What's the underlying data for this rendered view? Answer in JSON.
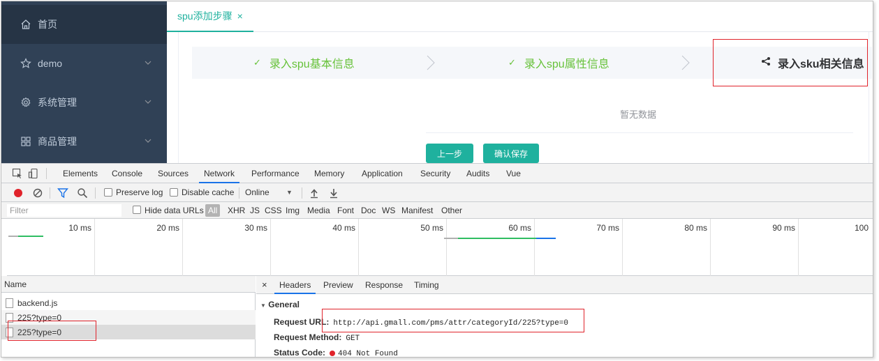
{
  "sidebar": {
    "items": [
      {
        "label": "首页",
        "icon": "home-icon"
      },
      {
        "label": "demo",
        "icon": "star-icon"
      },
      {
        "label": "系统管理",
        "icon": "gear-icon"
      },
      {
        "label": "商品管理",
        "icon": "grid-icon"
      }
    ],
    "bg_color": "#304156",
    "text_color": "#bfcbd9"
  },
  "tabs": {
    "active_label": "spu添加步骤",
    "close_glyph": "×"
  },
  "steps": [
    {
      "label": "录入spu基本信息",
      "status": "done",
      "check": "✓"
    },
    {
      "label": "录入spu属性信息",
      "status": "done",
      "check": "✓"
    },
    {
      "label": "录入sku相关信息",
      "status": "current",
      "icon": "share-icon"
    }
  ],
  "empty": {
    "text": "暂无数据"
  },
  "buttons": {
    "prev": "上一步",
    "confirm": "确认保存"
  },
  "accent_color": "#1fb19e",
  "devtools": {
    "tabs": [
      "Elements",
      "Console",
      "Sources",
      "Network",
      "Performance",
      "Memory",
      "Application",
      "Security",
      "Audits",
      "Vue"
    ],
    "active_tab": "Network",
    "toolbar": {
      "preserve_log": "Preserve log",
      "disable_cache": "Disable cache",
      "throttle": "Online",
      "throttle_arrow": "▼"
    },
    "filter": {
      "placeholder": "Filter",
      "hide_data_urls": "Hide data URLs",
      "types": [
        "All",
        "XHR",
        "JS",
        "CSS",
        "Img",
        "Media",
        "Font",
        "Doc",
        "WS",
        "Manifest",
        "Other"
      ]
    },
    "timeline": {
      "ticks": [
        "10 ms",
        "20 ms",
        "30 ms",
        "40 ms",
        "50 ms",
        "60 ms",
        "70 ms",
        "80 ms",
        "90 ms",
        "100"
      ]
    },
    "requests": {
      "header": "Name",
      "rows": [
        "backend.js",
        "225?type=0",
        "225?type=0"
      ],
      "selected_index": 2
    },
    "detail": {
      "close_glyph": "×",
      "tabs": [
        "Headers",
        "Preview",
        "Response",
        "Timing"
      ],
      "active_tab": "Headers",
      "section_title": "General",
      "section_arrow": "▼",
      "request_url_key": "Request URL:",
      "request_url": "http://api.gmall.com/pms/attr/categoryId/225?type=0",
      "request_method_key": "Request Method:",
      "request_method": "GET",
      "status_code_key": "Status Code:",
      "status_code": "404 Not Found"
    }
  }
}
